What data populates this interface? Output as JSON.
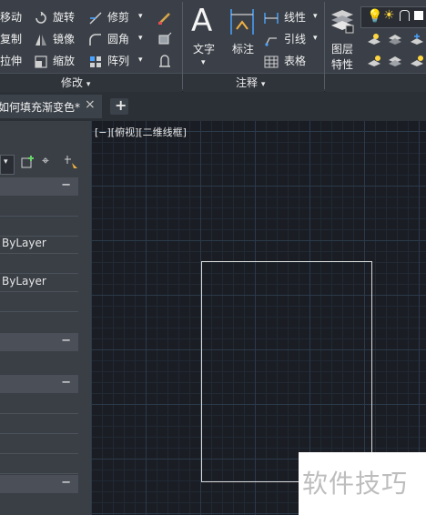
{
  "ribbon": {
    "modify": {
      "move": "移动",
      "rotate": "旋转",
      "trim": "修剪",
      "copy": "复制",
      "mirror": "镜像",
      "fillet": "圆角",
      "stretch": "拉伸",
      "scale": "缩放",
      "array": "阵列",
      "panel_title": "修改"
    },
    "annotation": {
      "text": "文字",
      "dimension": "标注",
      "linear": "线性",
      "leader": "引线",
      "table": "表格",
      "panel_title": "注释"
    },
    "layers": {
      "layer_properties_line1": "图层",
      "layer_properties_line2": "特性"
    },
    "icons": {
      "move": "move-icon",
      "rotate": "rotate-icon",
      "trim": "trim-icon",
      "copy": "copy-icon",
      "mirror": "mirror-icon",
      "fillet": "fillet-icon",
      "stretch": "stretch-icon",
      "scale": "scale-icon",
      "array": "array-icon",
      "erase": "erase-icon",
      "explode": "explode-icon",
      "offset": "offset-icon"
    }
  },
  "tabs": {
    "document": "如何填充渐变色*",
    "close": "×",
    "new_tab": "+"
  },
  "viewport": {
    "label": "[−][俯视][二维线框]"
  },
  "properties": {
    "rows": [
      {
        "type": "header",
        "text": "−"
      },
      {
        "type": "row",
        "text": ""
      },
      {
        "type": "row",
        "text": ""
      },
      {
        "type": "row",
        "text": "ByLayer"
      },
      {
        "type": "row",
        "text": ""
      },
      {
        "type": "row",
        "text": "ByLayer"
      },
      {
        "type": "row",
        "text": ""
      },
      {
        "type": "header",
        "text": "−"
      },
      {
        "type": "header",
        "text": "−"
      },
      {
        "type": "row",
        "text": ""
      },
      {
        "type": "row",
        "text": ""
      },
      {
        "type": "row",
        "text": ""
      },
      {
        "type": "row",
        "text": ""
      },
      {
        "type": "header",
        "text": "−"
      }
    ]
  },
  "watermark": {
    "text": "软件技巧"
  },
  "colors": {
    "canvas_bg": "#1a1d24",
    "ribbon_bg": "#3b4048",
    "accent_blue": "#4aa3ff"
  }
}
